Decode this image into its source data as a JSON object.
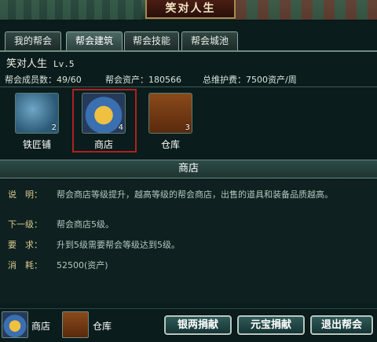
{
  "title": "笑对人生",
  "tabs": [
    {
      "label": "我的帮会"
    },
    {
      "label": "帮会建筑"
    },
    {
      "label": "帮会技能"
    },
    {
      "label": "帮会城池"
    }
  ],
  "active_tab": "帮会建筑",
  "guild": {
    "name": "笑对人生",
    "level": "Lv.5",
    "members": "帮会成员数：49/60",
    "assets": "帮会资产：180566",
    "maintenance": "总维护费：7500资产/周"
  },
  "buildings": [
    {
      "name": "铁匠铺",
      "level": "2",
      "icon": "anvil-icon"
    },
    {
      "name": "商店",
      "level": "4",
      "icon": "shop-icon",
      "selected": true
    },
    {
      "name": "仓库",
      "level": "3",
      "icon": "warehouse-icon"
    }
  ],
  "detail": {
    "header": "商店",
    "rows": [
      {
        "key": "说　明：",
        "value": "帮会商店等级提升，越高等级的帮会商店，出售的道具和装备品质越高。"
      },
      {
        "key": "下一级：",
        "value": "帮会商店5级。"
      },
      {
        "key": "要　求：",
        "value": "升到5级需要帮会等级达到5级。"
      },
      {
        "key": "消　耗：",
        "value": "52500(资产)"
      }
    ]
  },
  "bottom": {
    "shortcuts": [
      {
        "label": "商店",
        "icon": "shop-icon"
      },
      {
        "label": "仓库",
        "icon": "warehouse-icon"
      }
    ],
    "buttons": {
      "donate_silver": "银两捐献",
      "donate_ingot": "元宝捐献",
      "quit_guild": "退出帮会"
    }
  },
  "colors": {
    "background": "#0b1c1c",
    "selection_frame": "#b02020",
    "title_plate": "#4a1d14",
    "label_key": "#d9c98f"
  }
}
